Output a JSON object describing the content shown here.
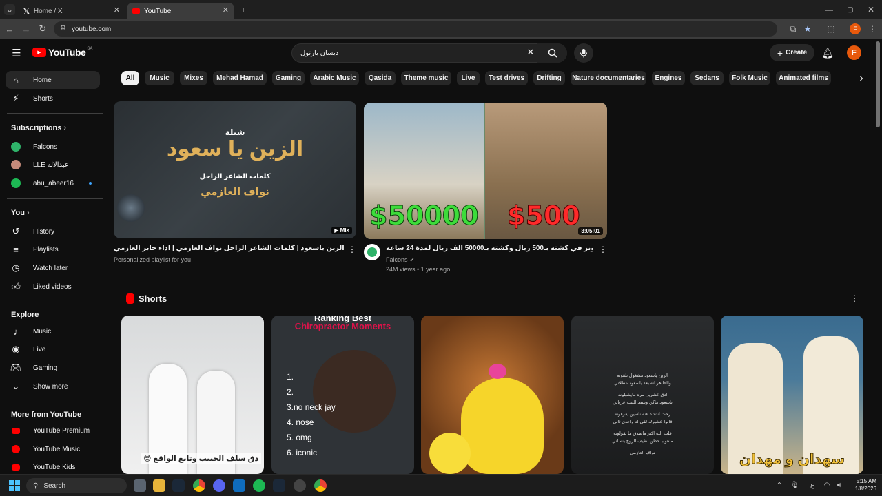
{
  "browser": {
    "tabs": [
      {
        "title": "Home / X",
        "icon": "x-logo-icon"
      },
      {
        "title": "YouTube",
        "icon": "youtube-logo-icon"
      }
    ],
    "url": "youtube.com",
    "profile_initial": "F"
  },
  "masthead": {
    "logo_text": "YouTube",
    "region": "SA",
    "search_value": "ديسان بارتول",
    "create_label": "Create",
    "avatar_initial": "F"
  },
  "sidebar": {
    "main": [
      {
        "label": "Home",
        "icon": "home-icon"
      },
      {
        "label": "Shorts",
        "icon": "shorts-icon"
      }
    ],
    "subscriptions_heading": "Subscriptions",
    "subscriptions": [
      {
        "label": "Falcons",
        "color": "#2fb36a"
      },
      {
        "label": "LLE عبدالاله",
        "color": "#c58a7a"
      },
      {
        "label": "abu_abeer16",
        "color": "#1db954"
      }
    ],
    "you_heading": "You",
    "you": [
      {
        "label": "History",
        "icon": "history-icon"
      },
      {
        "label": "Playlists",
        "icon": "playlists-icon"
      },
      {
        "label": "Watch later",
        "icon": "watch-later-icon"
      },
      {
        "label": "Liked videos",
        "icon": "liked-icon"
      }
    ],
    "explore_heading": "Explore",
    "explore": [
      {
        "label": "Music",
        "icon": "music-icon"
      },
      {
        "label": "Live",
        "icon": "live-icon"
      },
      {
        "label": "Gaming",
        "icon": "gaming-icon"
      },
      {
        "label": "Show more",
        "icon": "chevron-down-icon"
      }
    ],
    "more_heading": "More from YouTube",
    "more": [
      {
        "label": "YouTube Premium"
      },
      {
        "label": "YouTube Music"
      },
      {
        "label": "YouTube Kids"
      }
    ]
  },
  "chips": [
    "All",
    "Music",
    "Mixes",
    "Mehad Hamad",
    "Gaming",
    "Arabic Music",
    "Qasida",
    "Theme music",
    "Live",
    "Test drives",
    "Drifting",
    "Nature documentaries",
    "Engines",
    "Sedans",
    "Folk Music",
    "Animated films"
  ],
  "videos": [
    {
      "title": "شيلة الزين ياسعود | كلمات الشاعر الراحل نواف العازمي | اداء جابر العازمي - Mix",
      "sub": "Personalized playlist for you",
      "badge": "Mix",
      "thumb_line1": "شيلة",
      "thumb_line2": "الزين يا سعود",
      "thumb_line3": "كلمات الشاعر الراحل",
      "thumb_line4": "نواف العازمي"
    },
    {
      "title": "فالكونز في كشتة بـ500 ريال وكشتة بـ50000 الف ريال لمدة 24 ساعة 🔥🍃",
      "channel": "Falcons",
      "meta": "24M views • 1 year ago",
      "badge": "3:05:01",
      "left_price": "$50000",
      "right_price": "$500"
    }
  ],
  "shorts": {
    "heading": "Shorts",
    "items": [
      {
        "caption": "دق سلف الحبيب وتابع الواقع 😎"
      },
      {
        "top1": "Ranking Best",
        "top2": "Chiropractor Moments",
        "list": [
          "1.",
          "2.",
          "3.no neck jay",
          "4. nose",
          "5. omg",
          "6. iconic"
        ]
      },
      {
        "caption": ""
      },
      {
        "lines": [
          "الزين ياسعود مشغول تلقونه",
          "والظاهر انه بعد ياسعود عطلاني",
          "ادق عشرين مره مايشيلونه",
          "ياسعود ماكن وسط البيت عرياني",
          "رحت انتشد عنه ناسين يعرفونه",
          "قالوا عشيرك لقى له واحدن ثاني",
          "قلت الله اكبر ماصدق ما تقولونه",
          "ماهو بـ حظن لطيف الروح ينساني",
          "نواف العازمي"
        ]
      },
      {
        "caption": "سهدان و مهدان"
      }
    ]
  },
  "taskbar": {
    "search_label": "Search",
    "time": "5:15 AM",
    "date": "1/8/2026"
  }
}
